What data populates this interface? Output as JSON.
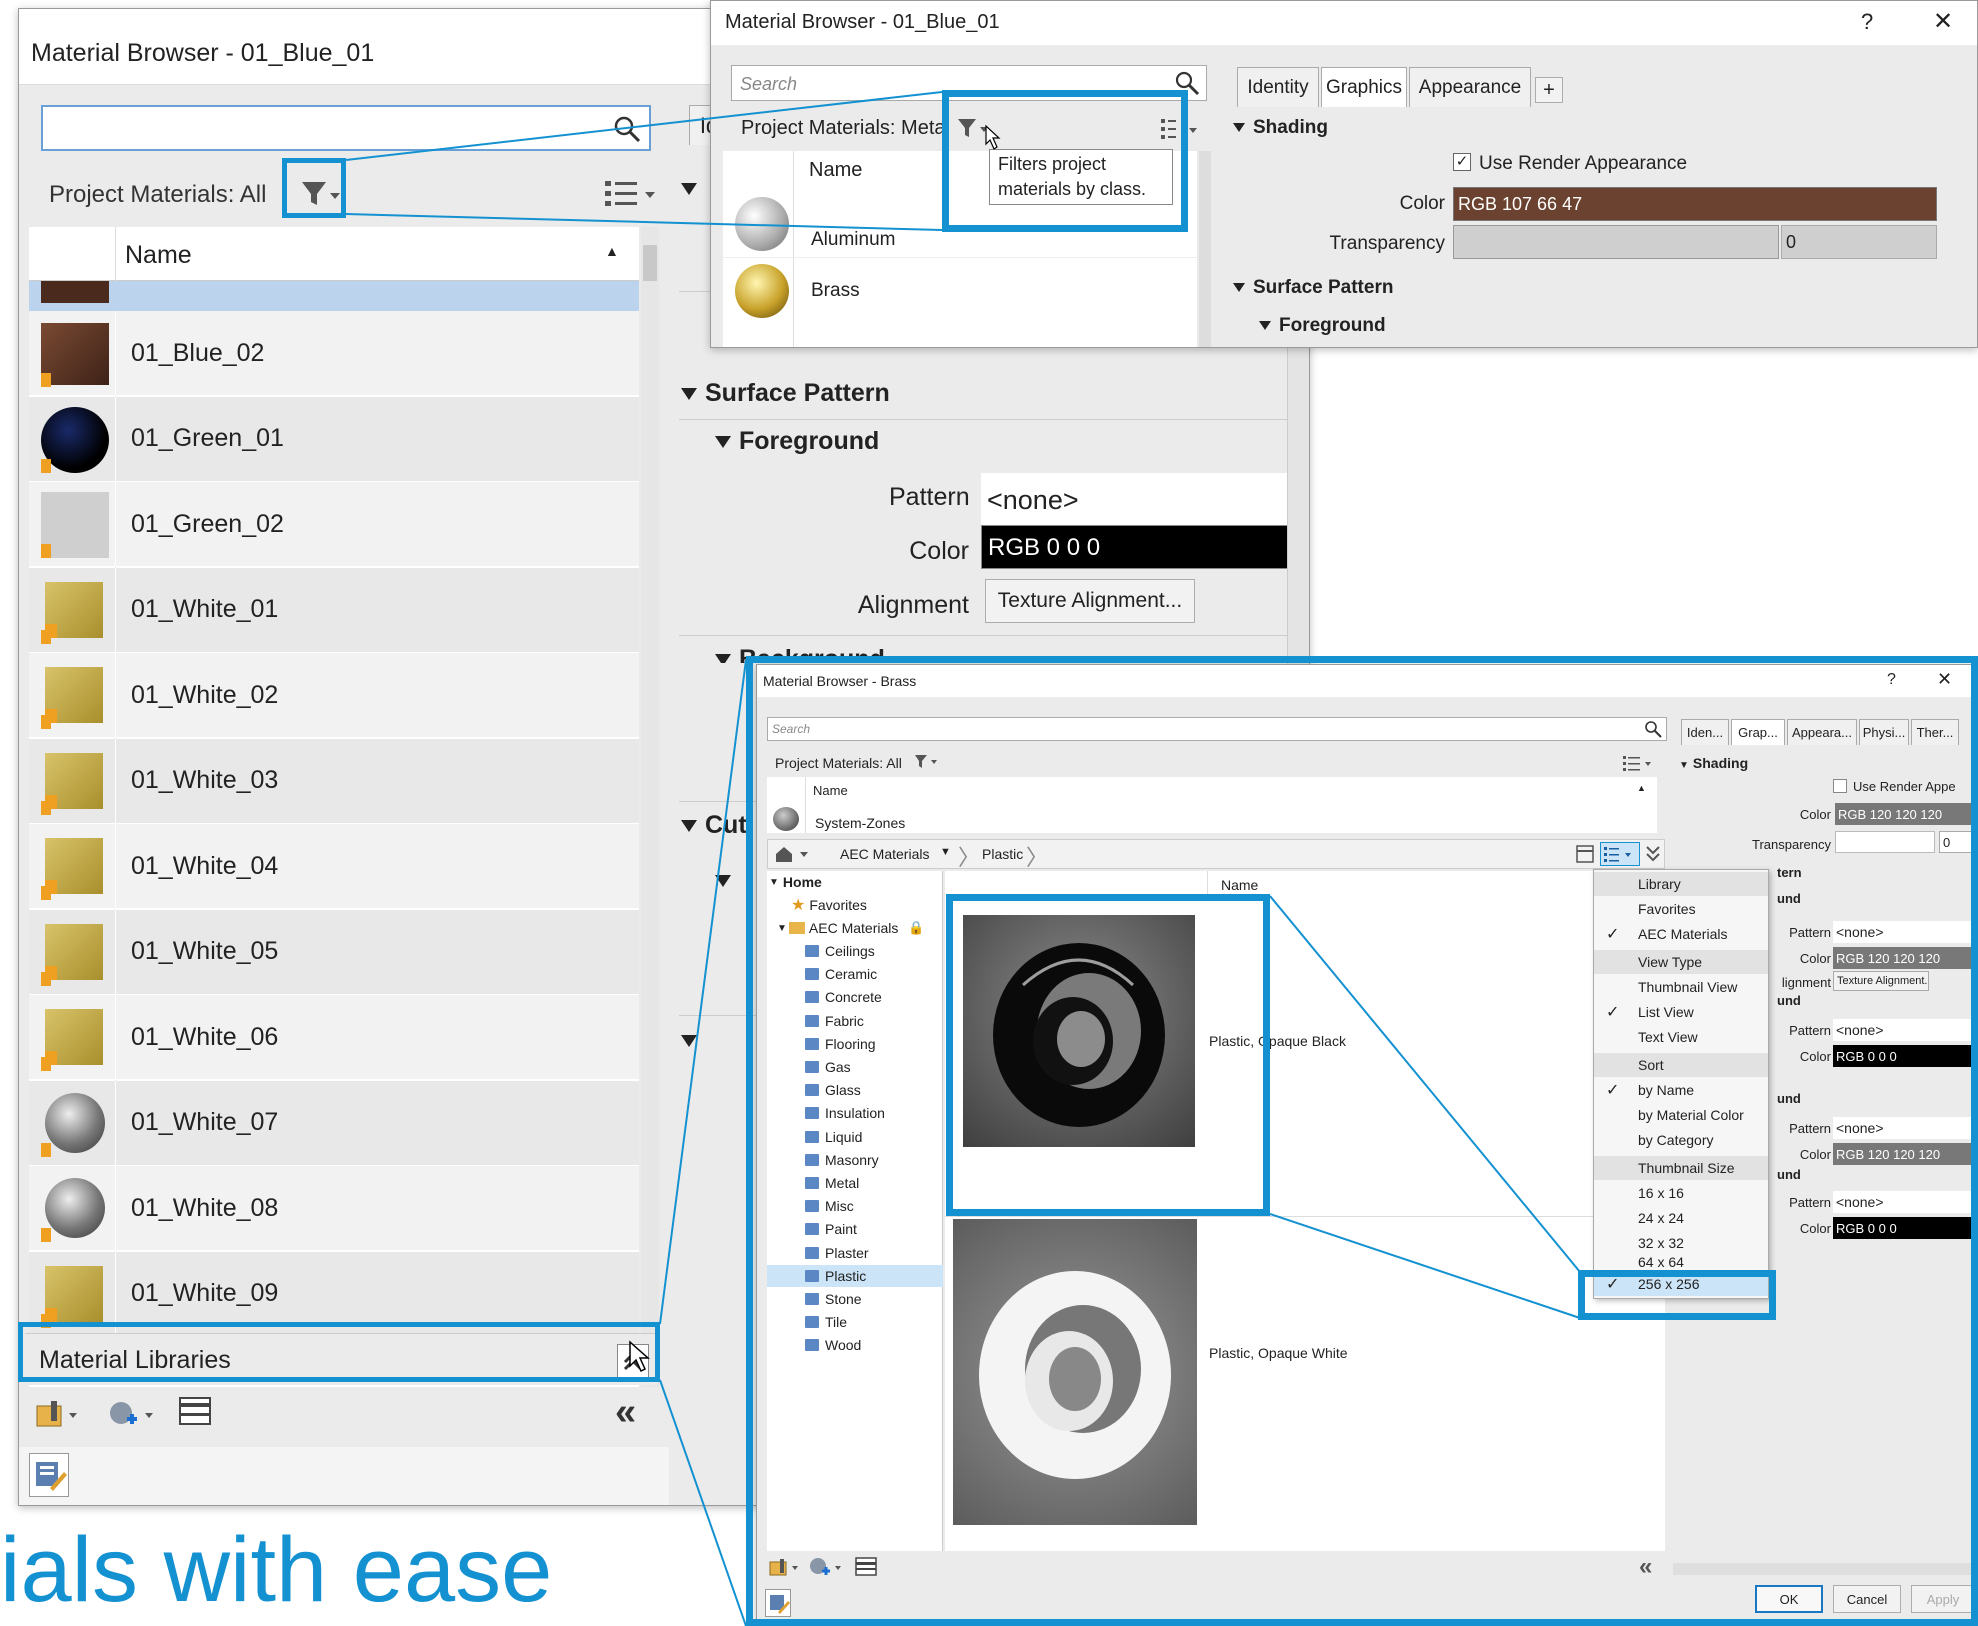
{
  "win1": {
    "title": "Material Browser - 01_Blue_01",
    "search_placeholder": "",
    "filter_label": "Project Materials: All",
    "column_name": "Name",
    "materials": [
      "01_Blue_02",
      "01_Green_01",
      "01_Green_02",
      "01_White_01",
      "01_White_02",
      "01_White_03",
      "01_White_04",
      "01_White_05",
      "01_White_06",
      "01_White_07",
      "01_White_08",
      "01_White_09"
    ],
    "libraries_label": "Material Libraries",
    "collapse_glyph": "«"
  },
  "props_mid": {
    "tab_partial": "Id",
    "surface_pattern": "Surface Pattern",
    "foreground": "Foreground",
    "pattern_label": "Pattern",
    "pattern_value": "<none>",
    "color_label": "Color",
    "color_value": "RGB 0 0 0",
    "alignment_label": "Alignment",
    "alignment_button": "Texture Alignment...",
    "background_partial": "Background",
    "cut_partial": "Cut"
  },
  "win2": {
    "title": "Material Browser - 01_Blue_01",
    "help": "?",
    "close": "✕",
    "search_placeholder": "Search",
    "filter_label": "Project Materials: Meta",
    "tooltip": "Filters project materials by class.",
    "column_name": "Name",
    "materials": [
      "Aluminum",
      "Brass"
    ],
    "tabs": [
      "Identity",
      "Graphics",
      "Appearance"
    ],
    "add_tab": "+",
    "shading": "Shading",
    "use_render": "Use Render Appearance",
    "color_label": "Color",
    "color_value": "RGB 107 66 47",
    "color_hex": "#6b422f",
    "transparency_label": "Transparency",
    "transparency_value": "0",
    "surface_pattern": "Surface Pattern",
    "foreground": "Foreground"
  },
  "win3": {
    "title": "Material Browser - Brass",
    "help": "?",
    "close": "✕",
    "search_placeholder": "Search",
    "filter_label": "Project Materials: All",
    "column_name": "Name",
    "project_row": "System-Zones",
    "breadcrumb": [
      "AEC Materials",
      "Plastic"
    ],
    "tree": {
      "home": "Home",
      "favorites": "Favorites",
      "aec": "AEC Materials",
      "children": [
        "Ceilings",
        "Ceramic",
        "Concrete",
        "Fabric",
        "Flooring",
        "Gas",
        "Glass",
        "Insulation",
        "Liquid",
        "Masonry",
        "Metal",
        "Misc",
        "Paint",
        "Plaster",
        "Plastic",
        "Stone",
        "Tile",
        "Wood"
      ],
      "selected": "Plastic"
    },
    "list_column": "Name",
    "items": [
      "Plastic, Opaque Black",
      "Plastic, Opaque White"
    ],
    "menu": {
      "library_head": "Library",
      "favorites": "Favorites",
      "aec": "AEC Materials",
      "view_head": "View Type",
      "thumb_view": "Thumbnail View",
      "list_view": "List View",
      "text_view": "Text View",
      "sort_head": "Sort",
      "by_name": "by Name",
      "by_color": "by Material Color",
      "by_category": "by Category",
      "size_head": "Thumbnail Size",
      "s16": "16 x 16",
      "s24": "24 x 24",
      "s32": "32 x 32",
      "s64": "64 x 64",
      "s256": "256 x 256",
      "check": "✓"
    },
    "tabs": [
      "Iden...",
      "Grap...",
      "Appeara...",
      "Physi...",
      "Ther..."
    ],
    "shading": "Shading",
    "use_render": "Use Render Appe",
    "color_label": "Color",
    "shade_color": "RGB 120 120 120",
    "transparency_label": "Transparency",
    "transparency_value": "0",
    "sec_tern": "tern",
    "sec_und": "und",
    "pattern_label": "Pattern",
    "none": "<none>",
    "alignment_label": "lignment",
    "alignment_button": "Texture Alignment...",
    "black": "RGB 0 0 0",
    "grey": "RGB 120 120 120",
    "collapse_glyph": "«",
    "ok": "OK",
    "cancel": "Cancel",
    "apply": "Apply"
  },
  "headline": "ials with ease",
  "accent": "#1391d1"
}
